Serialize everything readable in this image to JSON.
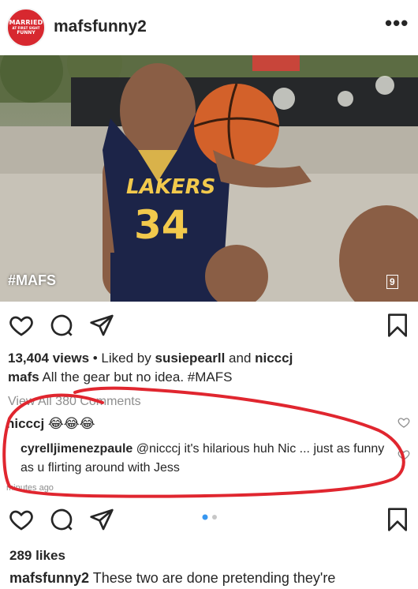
{
  "header": {
    "username": "mafsfunny2",
    "avatar_text": [
      "MARRIED",
      "AT FIRST SIGHT",
      "FUNNY"
    ],
    "more_label": "•••"
  },
  "media": {
    "hashtag_overlay": "#MAFS",
    "channel_logo": "9",
    "jersey_text": "LAKERS",
    "jersey_number": "34"
  },
  "post": {
    "views": "13,404 views",
    "liked_by_prefix": " • Liked by ",
    "liked_user_1": "susiepearll",
    "and_word": " and ",
    "liked_user_2": "nicccj",
    "caption_user": "mafs",
    "caption_text": " All the gear but no idea. #MAFS",
    "view_all_comments": "View All 380 Comments",
    "comments": [
      {
        "user": "nicccj",
        "text": " 😂😂😂"
      }
    ],
    "reply": {
      "user": "cyrelljimenezpaule",
      "text": " @nicccj it's hilarious huh Nic ... just as funny as u flirting around with Jess"
    },
    "time_ago": "minutes ago"
  },
  "post2": {
    "likes": "289 likes",
    "caption_user": "mafsfunny2",
    "caption_text": " These two are done pretending they're"
  },
  "colors": {
    "text": "#262626",
    "muted": "#8e8e8e",
    "accent_blue": "#3897f0",
    "annotation_red": "#e0262f"
  },
  "icons": [
    "heart-icon",
    "comment-icon",
    "share-icon",
    "bookmark-icon"
  ]
}
